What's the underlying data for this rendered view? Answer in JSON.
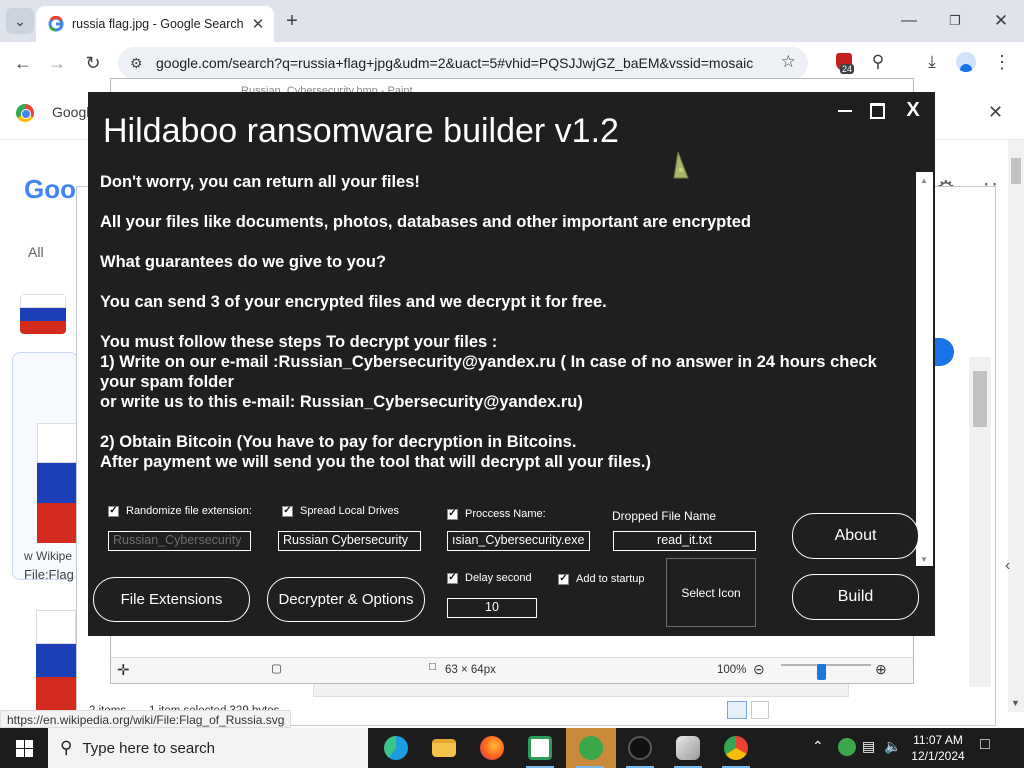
{
  "browser": {
    "tab_title": "russia flag.jpg - Google Search",
    "new_tab_icon": "plus-icon",
    "url": "google.com/search?q=russia+flag+jpg&udm=2&uact=5#vhid=PQSJJwjGZ_baEM&vssid=mosaic",
    "extension_badge": "24"
  },
  "google_page": {
    "strip_text": "Googl",
    "logo_text": "Goo",
    "tab_all": "All",
    "tab_partial": "In",
    "wiki_source": "w Wikipe",
    "wiki_file": "File:Flag"
  },
  "paint": {
    "title": "Russian_Cybersecurity.bmp - Paint",
    "dimensions": "63 × 64px",
    "zoom": "100%"
  },
  "explorer": {
    "items": "2 items",
    "selection": "1 item selected  329 bytes"
  },
  "builder": {
    "title": "Hildaboo ransomware builder v1.2",
    "note": [
      "Don't worry, you can return all your files!",
      "All your files like documents, photos, databases and other important are encrypted",
      "What guarantees do we give to you?",
      "You can send 3 of your encrypted files and we decrypt it for free.",
      "You must follow these steps To decrypt your files :",
      "1) Write on our e-mail :Russian_Cybersecurity@yandex.ru ( In case of no answer in 24 hours check your spam folder",
      "or write us to this e-mail: Russian_Cybersecurity@yandex.ru)",
      "2) Obtain Bitcoin (You have to pay for decryption in Bitcoins.",
      "After payment we will send you the tool that will decrypt all your files.)"
    ],
    "options": {
      "randomize_label": "Randomize file extension:",
      "randomize_checked": true,
      "randomize_value": "Russian_Cybersecurity",
      "spread_label": "Spread Local Drives",
      "spread_checked": true,
      "spread_value": "Russian Cybersecurity",
      "process_label": "Proccess Name:",
      "process_checked": true,
      "process_value": "ısian_Cybersecurity.exe",
      "dropped_label": "Dropped File Name",
      "dropped_value": "read_it.txt",
      "delay_label": "Delay second",
      "delay_checked": true,
      "delay_value": "10",
      "startup_label": "Add to startup",
      "startup_checked": true,
      "select_icon_label": "Select Icon"
    },
    "buttons": {
      "about": "About",
      "build": "Build",
      "file_extensions": "File Extensions",
      "decrypter_options": "Decrypter & Options"
    },
    "close_label": "X"
  },
  "status_url": "https://en.wikipedia.org/wiki/File:Flag_of_Russia.svg",
  "taskbar": {
    "search_placeholder": "Type here to search",
    "time": "11:07 AM",
    "date": "12/1/2024",
    "apps": [
      "edge-icon",
      "file-explorer-icon",
      "firefox-icon",
      "paint-icon",
      "green-app-icon",
      "hildaboo-builder-icon",
      "paint-3d-icon",
      "chrome-icon"
    ]
  },
  "colors": {
    "builder_bg": "#1f1f1f",
    "chrome_tabbar": "#dfe3eb",
    "taskbar": "#1c1c1c",
    "accent_blue": "#1a73e8"
  }
}
